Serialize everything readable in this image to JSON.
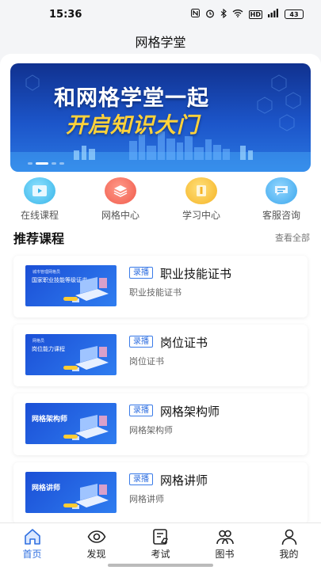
{
  "status_bar": {
    "time": "15:36",
    "network": "HD",
    "battery": "43"
  },
  "header": {
    "title": "网格学堂"
  },
  "banner": {
    "line1": "和网格学堂一起",
    "line2": "开启知识大门"
  },
  "quick_nav": [
    {
      "label": "在线课程",
      "icon": "play-video-icon",
      "color": "#35b4e8"
    },
    {
      "label": "网格中心",
      "icon": "layers-icon",
      "color": "#f05a4a"
    },
    {
      "label": "学习中心",
      "icon": "book-icon",
      "color": "#f5b324"
    },
    {
      "label": "客服咨询",
      "icon": "chat-bubble-icon",
      "color": "#3aa6ec"
    }
  ],
  "recommend": {
    "title": "推荐课程",
    "more": "查看全部"
  },
  "courses": [
    {
      "badge": "录播",
      "title": "职业技能证书",
      "subtitle": "职业技能证书",
      "thumb_top": "城市管理网格员",
      "thumb_main": "国家职业技能等级证书"
    },
    {
      "badge": "录播",
      "title": "岗位证书",
      "subtitle": "岗位证书",
      "thumb_top": "网格员",
      "thumb_main": "岗位能力课程"
    },
    {
      "badge": "录播",
      "title": "网格架构师",
      "subtitle": "网格架构师",
      "thumb_main": "网格架构师"
    },
    {
      "badge": "录播",
      "title": "网格讲师",
      "subtitle": "网格讲师",
      "thumb_main": "网格讲师"
    }
  ],
  "tabbar": [
    {
      "label": "首页",
      "icon": "home-icon",
      "active": true
    },
    {
      "label": "发现",
      "icon": "eye-icon",
      "active": false
    },
    {
      "label": "考试",
      "icon": "exam-icon",
      "active": false
    },
    {
      "label": "图书",
      "icon": "people-icon",
      "active": false
    },
    {
      "label": "我的",
      "icon": "profile-icon",
      "active": false
    }
  ],
  "colors": {
    "accent": "#2f6fe0",
    "banner_highlight": "#ffd23a"
  }
}
